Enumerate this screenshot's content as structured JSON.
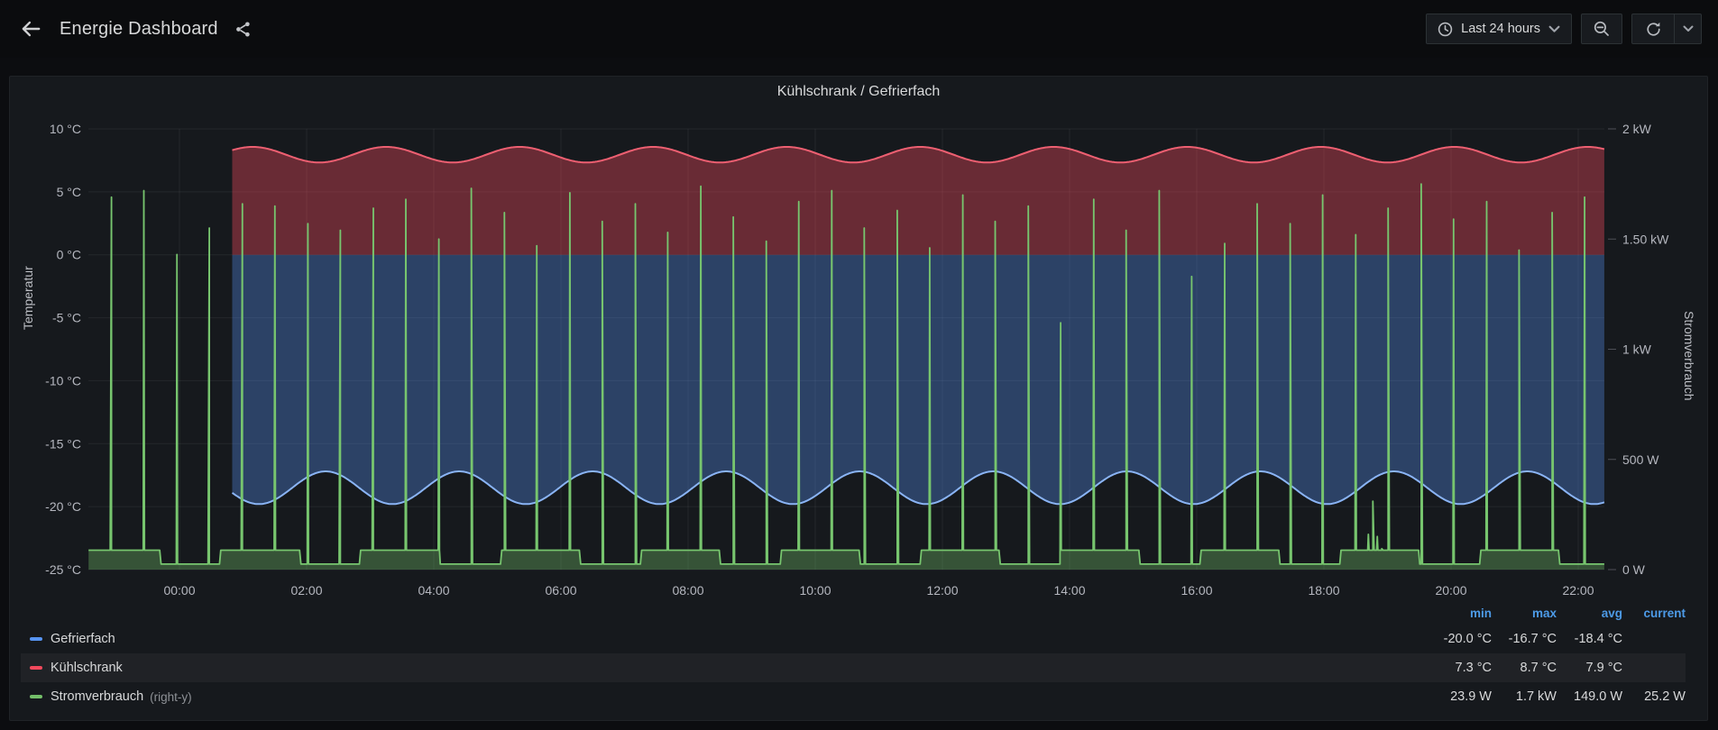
{
  "header": {
    "title": "Energie Dashboard",
    "time_picker_label": "Last 24 hours"
  },
  "panel": {
    "title": "Kühlschrank / Gefrierfach"
  },
  "colors": {
    "gefrierfach": "#5794F2",
    "kuehlschrank": "#F2495C",
    "stromverbrauch": "#73BF69",
    "legend_header": "#4d9be8",
    "grid": "rgba(204,204,220,0.08)",
    "axis_text": "#b5b7bf"
  },
  "chart_data": {
    "type": "line",
    "title": "Kühlschrank / Gefrierfach",
    "x_axis": {
      "tick_labels": [
        "00:00",
        "02:00",
        "04:00",
        "06:00",
        "08:00",
        "10:00",
        "12:00",
        "14:00",
        "16:00",
        "18:00",
        "20:00",
        "22:00"
      ],
      "tick_hours": [
        0,
        2,
        4,
        6,
        8,
        10,
        12,
        14,
        16,
        18,
        20,
        22
      ],
      "domain_hours": [
        -1.43,
        22.41
      ],
      "grid": true
    },
    "y_left": {
      "label": "Temperatur",
      "tick_labels": [
        "10 °C",
        "5 °C",
        "0 °C",
        "-5 °C",
        "-10 °C",
        "-15 °C",
        "-20 °C",
        "-25 °C"
      ],
      "tick_values": [
        10,
        5,
        0,
        -5,
        -10,
        -15,
        -20,
        -25
      ],
      "range": [
        -25,
        10
      ]
    },
    "y_right": {
      "label": "Stromverbrauch",
      "tick_labels": [
        "2 kW",
        "1.50 kW",
        "1 kW",
        "500 W",
        "0 W"
      ],
      "tick_values": [
        2000,
        1500,
        1000,
        500,
        0
      ],
      "range": [
        0,
        2000
      ]
    },
    "legend": {
      "columns": [
        "min",
        "max",
        "avg",
        "current"
      ],
      "position": "bottom-table"
    },
    "series": [
      {
        "name": "Gefrierfach",
        "suffix": "",
        "color": "#5794F2",
        "axis": "left",
        "unit": "°C",
        "fill_opacity": 0.34,
        "line_color": "#8ab4f5",
        "model": {
          "kind": "cosine",
          "base": -18.5,
          "amplitude": 1.3,
          "period_h": 2.1,
          "peak_h": 0.2,
          "start_h": 0.83,
          "end_h": 22.41,
          "fill_to_value": 0
        },
        "stats": {
          "min": "-20.0 °C",
          "max": "-16.7 °C",
          "avg": "-18.4 °C",
          "current": ""
        }
      },
      {
        "name": "Kühlschrank",
        "suffix": "",
        "color": "#F2495C",
        "axis": "left",
        "unit": "°C",
        "fill_opacity": 0.38,
        "line_color": "#ed5f71",
        "model": {
          "kind": "cosine",
          "base": 7.95,
          "amplitude": 0.62,
          "period_h": 2.1,
          "peak_h": 1.15,
          "start_h": 0.83,
          "end_h": 22.41,
          "fill_to_value": 0
        },
        "stats": {
          "min": "7.3 °C",
          "max": "8.7 °C",
          "avg": "7.9 °C",
          "current": ""
        }
      },
      {
        "name": "Stromverbrauch",
        "suffix": "(right-y)",
        "color": "#73BF69",
        "axis": "right",
        "unit": "W",
        "fill_opacity": 0.35,
        "line_color": "#77c56e",
        "model": {
          "kind": "baseline-spikes",
          "start_h": -1.43,
          "end_h": 22.41,
          "baseline": {
            "plateau_w": 88,
            "low_w": 25,
            "period_h": 2.2,
            "low_offset_h": -0.3,
            "low_duration_h": 0.95,
            "tail_low_from_h": 21.95
          },
          "spikes_h_kw": [
            [
              -1.07,
              1.69
            ],
            [
              -0.56,
              1.72
            ],
            [
              -0.04,
              1.43
            ],
            [
              0.47,
              1.55
            ],
            [
              0.99,
              1.66
            ],
            [
              1.5,
              1.65
            ],
            [
              2.02,
              1.57
            ],
            [
              2.53,
              1.54
            ],
            [
              3.05,
              1.64
            ],
            [
              3.56,
              1.68
            ],
            [
              4.08,
              1.5
            ],
            [
              4.59,
              1.73
            ],
            [
              5.11,
              1.62
            ],
            [
              5.62,
              1.47
            ],
            [
              6.14,
              1.71
            ],
            [
              6.65,
              1.58
            ],
            [
              7.17,
              1.66
            ],
            [
              7.68,
              1.53
            ],
            [
              8.2,
              1.74
            ],
            [
              8.71,
              1.6
            ],
            [
              9.23,
              1.49
            ],
            [
              9.74,
              1.67
            ],
            [
              10.26,
              1.72
            ],
            [
              10.77,
              1.55
            ],
            [
              11.29,
              1.63
            ],
            [
              11.8,
              1.46
            ],
            [
              12.32,
              1.7
            ],
            [
              12.83,
              1.58
            ],
            [
              13.35,
              1.65
            ],
            [
              13.86,
              1.12
            ],
            [
              14.38,
              1.68
            ],
            [
              14.89,
              1.54
            ],
            [
              15.41,
              1.72
            ],
            [
              15.92,
              1.33
            ],
            [
              16.44,
              1.48
            ],
            [
              16.95,
              1.66
            ],
            [
              17.47,
              1.57
            ],
            [
              17.98,
              1.7
            ],
            [
              18.5,
              1.52
            ],
            [
              19.01,
              1.64
            ],
            [
              19.53,
              1.75
            ],
            [
              20.04,
              1.59
            ],
            [
              20.56,
              1.67
            ],
            [
              21.07,
              1.45
            ],
            [
              21.59,
              1.62
            ],
            [
              22.1,
              1.69
            ]
          ],
          "noise_h_w": [
            [
              18.7,
              160
            ],
            [
              18.77,
              310
            ],
            [
              18.84,
              150
            ],
            [
              18.91,
              95
            ]
          ]
        },
        "stats": {
          "min": "23.9 W",
          "max": "1.7 kW",
          "avg": "149.0 W",
          "current": "25.2 W"
        }
      }
    ]
  }
}
